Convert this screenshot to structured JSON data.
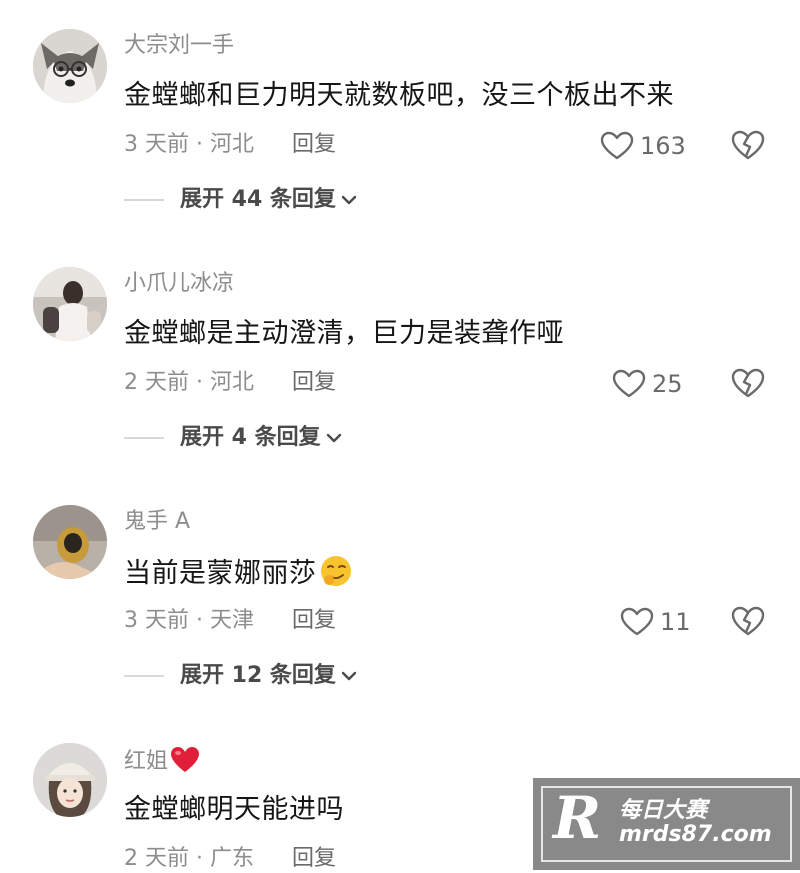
{
  "comments": [
    {
      "username": "大宗刘一手",
      "text": "金螳螂和巨力明天就数板吧，没三个板出不来",
      "time_location": "3 天前 · 河北",
      "reply_label": "回复",
      "likes": "163",
      "expand_label": "展开 44 条回复",
      "avatar_icon": "husky-dog-avatar"
    },
    {
      "username": "小爪儿冰凉",
      "text": "金螳螂是主动澄清，巨力是装聋作哑",
      "time_location": "2 天前 · 河北",
      "reply_label": "回复",
      "likes": "25",
      "expand_label": "展开 4 条回复",
      "avatar_icon": "photo-avatar"
    },
    {
      "username": "鬼手 A",
      "text": "当前是蒙娜丽莎",
      "emoji": "smirk-emoji",
      "time_location": "3 天前 · 天津",
      "reply_label": "回复",
      "likes": "11",
      "expand_label": "展开 12 条回复",
      "avatar_icon": "gold-object-avatar"
    },
    {
      "username": "红姐",
      "username_badge": "red-heart-icon",
      "text": "金螳螂明天能进吗",
      "time_location": "2 天前 · 广东",
      "reply_label": "回复",
      "avatar_icon": "girl-hat-avatar"
    }
  ],
  "watermark": {
    "logo": "R",
    "title": "每日大赛",
    "url": "mrds87.com"
  },
  "colors": {
    "text": "#161616",
    "secondary": "#8d8d8f",
    "heart_badge": "#e0203a"
  }
}
